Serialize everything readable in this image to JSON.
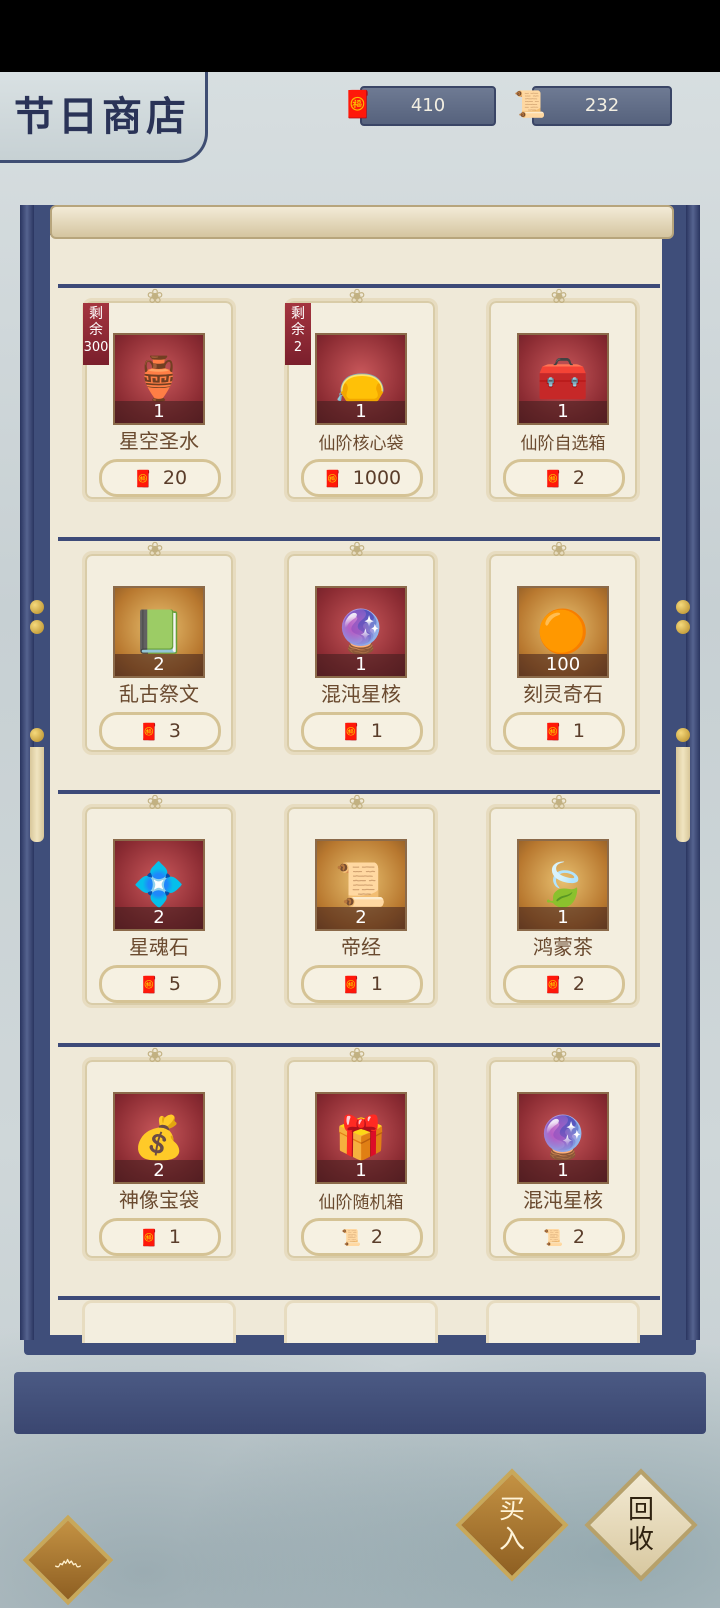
{
  "header": {
    "title": "节日商店",
    "currency1": {
      "icon": "red-ticket-icon",
      "value": "410"
    },
    "currency2": {
      "icon": "scroll-icon",
      "value": "232"
    }
  },
  "items": [
    {
      "name": "星空圣水",
      "icon": "gourd-icon",
      "glyph": "🏺",
      "qty": "1",
      "price": "20",
      "currency": "ticket",
      "badge": {
        "line1": "剩",
        "line2": "余",
        "count": "300"
      }
    },
    {
      "name": "仙阶核心袋",
      "icon": "pouch-icon",
      "glyph": "👝",
      "qty": "1",
      "price": "1000",
      "currency": "ticket",
      "badge": {
        "line1": "剩",
        "line2": "余",
        "count": "2"
      }
    },
    {
      "name": "仙阶自选箱",
      "icon": "chest-icon",
      "glyph": "🧰",
      "qty": "1",
      "price": "2",
      "currency": "ticket"
    },
    {
      "name": "乱古祭文",
      "icon": "book-icon",
      "glyph": "📗",
      "qty": "2",
      "price": "3",
      "currency": "ticket",
      "gold": true
    },
    {
      "name": "混沌星核",
      "icon": "orb-icon",
      "glyph": "🔮",
      "qty": "1",
      "price": "1",
      "currency": "ticket"
    },
    {
      "name": "刻灵奇石",
      "icon": "stone-icon",
      "glyph": "🟠",
      "qty": "100",
      "price": "1",
      "currency": "ticket",
      "gold": true
    },
    {
      "name": "星魂石",
      "icon": "soul-stone-icon",
      "glyph": "💠",
      "qty": "2",
      "price": "5",
      "currency": "ticket"
    },
    {
      "name": "帝经",
      "icon": "scripture-icon",
      "glyph": "📜",
      "qty": "2",
      "price": "1",
      "currency": "ticket",
      "gold": true
    },
    {
      "name": "鸿蒙茶",
      "icon": "tea-leaf-icon",
      "glyph": "🍃",
      "qty": "1",
      "price": "2",
      "currency": "ticket",
      "gold": true
    },
    {
      "name": "神像宝袋",
      "icon": "treasure-bag-icon",
      "glyph": "💰",
      "qty": "2",
      "price": "1",
      "currency": "ticket"
    },
    {
      "name": "仙阶随机箱",
      "icon": "random-box-icon",
      "glyph": "🎁",
      "qty": "1",
      "price": "2",
      "currency": "scroll"
    },
    {
      "name": "混沌星核",
      "icon": "orb-icon",
      "glyph": "🔮",
      "qty": "1",
      "price": "2",
      "currency": "scroll"
    }
  ],
  "buttons": {
    "buy_line1": "买",
    "buy_line2": "入",
    "recycle_line1": "回",
    "recycle_line2": "收"
  },
  "colors": {
    "accent": "#3f4e7a",
    "price_red": "#b01f2f",
    "paper": "#efe9d8"
  }
}
